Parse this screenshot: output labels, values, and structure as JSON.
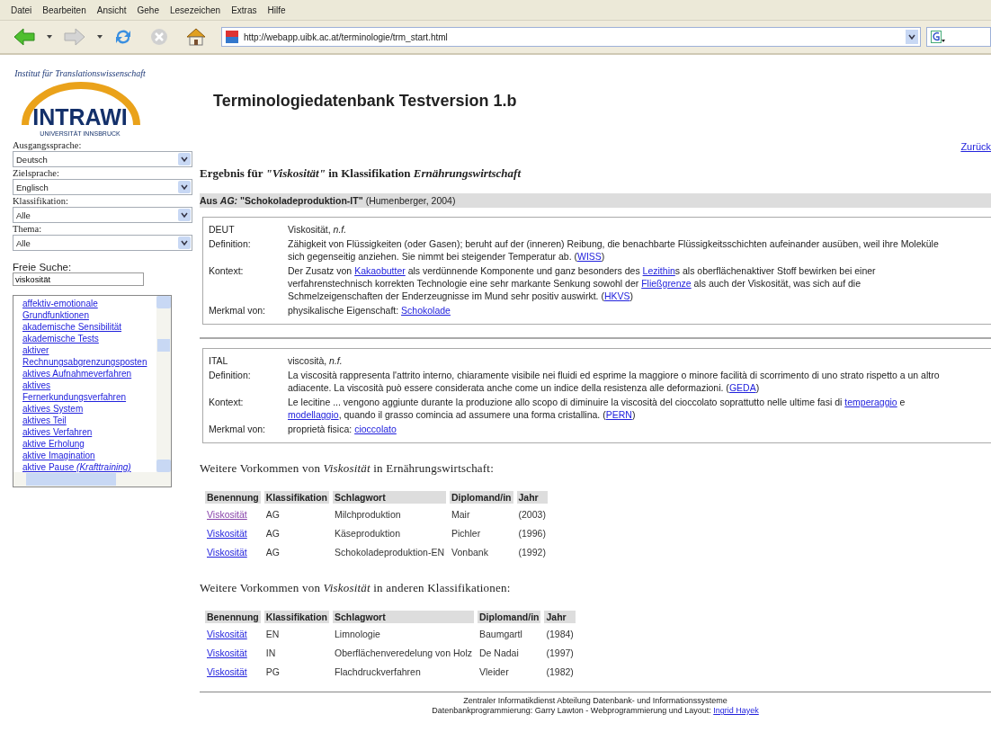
{
  "menu": [
    {
      "label": "Datei"
    },
    {
      "label": "Bearbeiten"
    },
    {
      "label": "Ansicht"
    },
    {
      "label": "Gehe"
    },
    {
      "label": "Lesezeichen"
    },
    {
      "label": "Extras"
    },
    {
      "label": "Hilfe"
    }
  ],
  "address": {
    "url": "http://webapp.uibk.ac.at/terminologie/trm_start.html"
  },
  "logo": {
    "arc_text": "Institut für Translationswissenschaft",
    "name": "INTRAWI",
    "university": "UNIVERSITÄT INNSBRUCK"
  },
  "title": "Terminologiedatenbank Testversion 1.b",
  "sidebar": {
    "selects": [
      {
        "label": "Ausgangssprache:",
        "value": "Deutsch"
      },
      {
        "label": "Zielsprache:",
        "value": "Englisch"
      },
      {
        "label": "Klassifikation:",
        "value": "Alle"
      },
      {
        "label": "Thema:",
        "value": "Alle"
      }
    ],
    "search": {
      "label": "Freie Suche:",
      "value": "viskosität"
    },
    "terms": [
      "affektiv-emotionale Grundfunktionen",
      "akademische Sensibilität",
      "akademische Tests",
      "aktiver Rechnungsabgrenzungsposten",
      "aktives Aufnahmeverfahren",
      "aktives Fernerkundungsverfahren",
      "aktives System",
      "aktives Teil",
      "aktives Verfahren",
      "aktive Erholung",
      "aktive Imagination",
      "aktive Pause *(Krafttraining)*"
    ]
  },
  "back_link": "Zurück",
  "result_heading": "Ergebnis für *\"Viskosität\"* in Klassifikation *Ernährungswirtschaft*",
  "source": {
    "prefix": "Aus",
    "classification": "AG:",
    "title": "\"Schokoladeproduktion-IT\"",
    "note": "(Humenberger, 2004)"
  },
  "entries": [
    {
      "lang": "DEUT",
      "term": "Viskosität, *n.f.*",
      "rows": [
        {
          "label": "Definition:",
          "parts": [
            {
              "text": "Zähigkeit von Flüssigkeiten (oder Gasen); beruht auf der (inneren) Reibung, die benachbarte Flüssigkeitsschichten aufeinander ausüben, weil ihre Moleküle sich gegenseitig anziehen. Sie nimmt bei steigender Temperatur ab. ("
            },
            {
              "link": "WISS"
            },
            {
              "text": ")"
            }
          ]
        },
        {
          "label": "Kontext:",
          "parts": [
            {
              "text": "Der Zusatz von "
            },
            {
              "link": "Kakaobutter"
            },
            {
              "text": " als verdünnende Komponente und ganz besonders des "
            },
            {
              "link": "Lezithin"
            },
            {
              "text": "s als oberflächenaktiver Stoff bewirken bei einer verfahrenstechnisch korrekten Technologie eine sehr markante Senkung sowohl der "
            },
            {
              "link": "Fließgrenze"
            },
            {
              "text": " als auch der Viskosität, was sich auf die Schmelzeigenschaften der Enderzeugnisse im Mund sehr positiv auswirkt. ("
            },
            {
              "link": "HKVS"
            },
            {
              "text": ")"
            }
          ]
        },
        {
          "label": "Merkmal von:",
          "parts": [
            {
              "text": "physikalische Eigenschaft: "
            },
            {
              "link": "Schokolade"
            }
          ]
        }
      ]
    },
    {
      "lang": "ITAL",
      "term": "viscosità, *n.f.*",
      "rows": [
        {
          "label": "Definition:",
          "parts": [
            {
              "text": "La viscosità rappresenta l'attrito interno, chiaramente visibile nei fluidi ed esprime la maggiore o minore facilità di scorrimento di uno strato rispetto a un altro adiacente. La viscosità può essere considerata anche come un indice della resistenza alle deformazioni. ("
            },
            {
              "link": "GEDA"
            },
            {
              "text": ")"
            }
          ]
        },
        {
          "label": "Kontext:",
          "parts": [
            {
              "text": "Le lecitine ... vengono aggiunte durante la produzione allo scopo di diminuire la viscosità del cioccolato soprattutto nelle ultime fasi di "
            },
            {
              "link": "temperaggio"
            },
            {
              "text": " e "
            },
            {
              "link": "modellaggio"
            },
            {
              "text": ", quando il grasso comincia ad assumere una forma cristallina. ("
            },
            {
              "link": "PERN"
            },
            {
              "text": ")"
            }
          ]
        },
        {
          "label": "Merkmal von:",
          "parts": [
            {
              "text": "proprietà fisica: "
            },
            {
              "link": "cioccolato"
            }
          ]
        }
      ]
    }
  ],
  "tables": [
    {
      "heading": "Weitere Vorkommen von *Viskosität* in Ernährungswirtschaft:",
      "columns": [
        "Benennung",
        "Klassifikation",
        "Schlagwort",
        "Diplomand/in",
        "Jahr"
      ],
      "rows": [
        {
          "visited": true,
          "cells": [
            "Viskosität",
            "AG",
            "Milchproduktion",
            "Mair",
            "(2003)"
          ]
        },
        {
          "visited": false,
          "cells": [
            "Viskosität",
            "AG",
            "Käseproduktion",
            "Pichler",
            "(1996)"
          ]
        },
        {
          "visited": false,
          "cells": [
            "Viskosität",
            "AG",
            "Schokoladeproduktion-EN",
            "Vonbank",
            "(1992)"
          ]
        }
      ]
    },
    {
      "heading": "Weitere Vorkommen von *Viskosität* in anderen Klassifikationen:",
      "columns": [
        "Benennung",
        "Klassifikation",
        "Schlagwort",
        "Diplomand/in",
        "Jahr"
      ],
      "rows": [
        {
          "visited": false,
          "cells": [
            "Viskosität",
            "EN",
            "Limnologie",
            "Baumgartl",
            "(1984)"
          ]
        },
        {
          "visited": false,
          "cells": [
            "Viskosität",
            "IN",
            "Oberflächenveredelung von Holz",
            "De Nadai",
            "(1997)"
          ]
        },
        {
          "visited": false,
          "cells": [
            "Viskosität",
            "PG",
            "Flachdruckverfahren",
            "Vleider",
            "(1982)"
          ]
        }
      ]
    }
  ],
  "footer": {
    "line1": "Zentraler Informatikdienst Abteilung Datenbank- und Informationssysteme",
    "line2": "Datenbankprogrammierung: Garry Lawton - Webprogrammierung und Layout: ",
    "author_link": "Ingrid Hayek"
  }
}
